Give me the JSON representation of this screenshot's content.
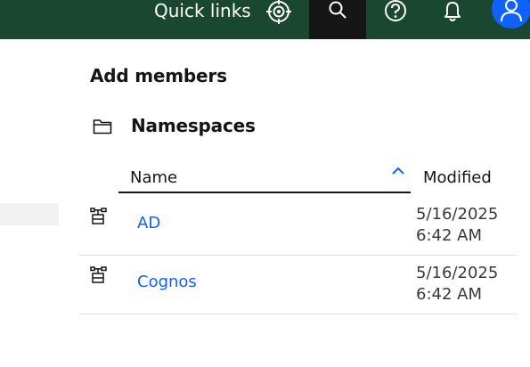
{
  "topbar": {
    "quick_links_label": "Quick links",
    "icons": [
      "crosshair-icon",
      "search-icon",
      "help-icon",
      "notification-icon",
      "user-avatar-icon"
    ],
    "background": "#1a4730",
    "active_background": "#161616",
    "avatar_color": "#0f62fe"
  },
  "panel": {
    "title": "Add members",
    "section_title": "Namespaces",
    "columns": {
      "name": "Name",
      "modified": "Modified"
    },
    "rows": [
      {
        "name": "AD",
        "modified_date": "5/16/2025",
        "modified_time": "6:42 AM",
        "icon": "namespace-icon"
      },
      {
        "name": "Cognos",
        "modified_date": "5/16/2025",
        "modified_time": "6:42 AM",
        "icon": "namespace-icon"
      }
    ],
    "link_color": "#0f62fe"
  }
}
